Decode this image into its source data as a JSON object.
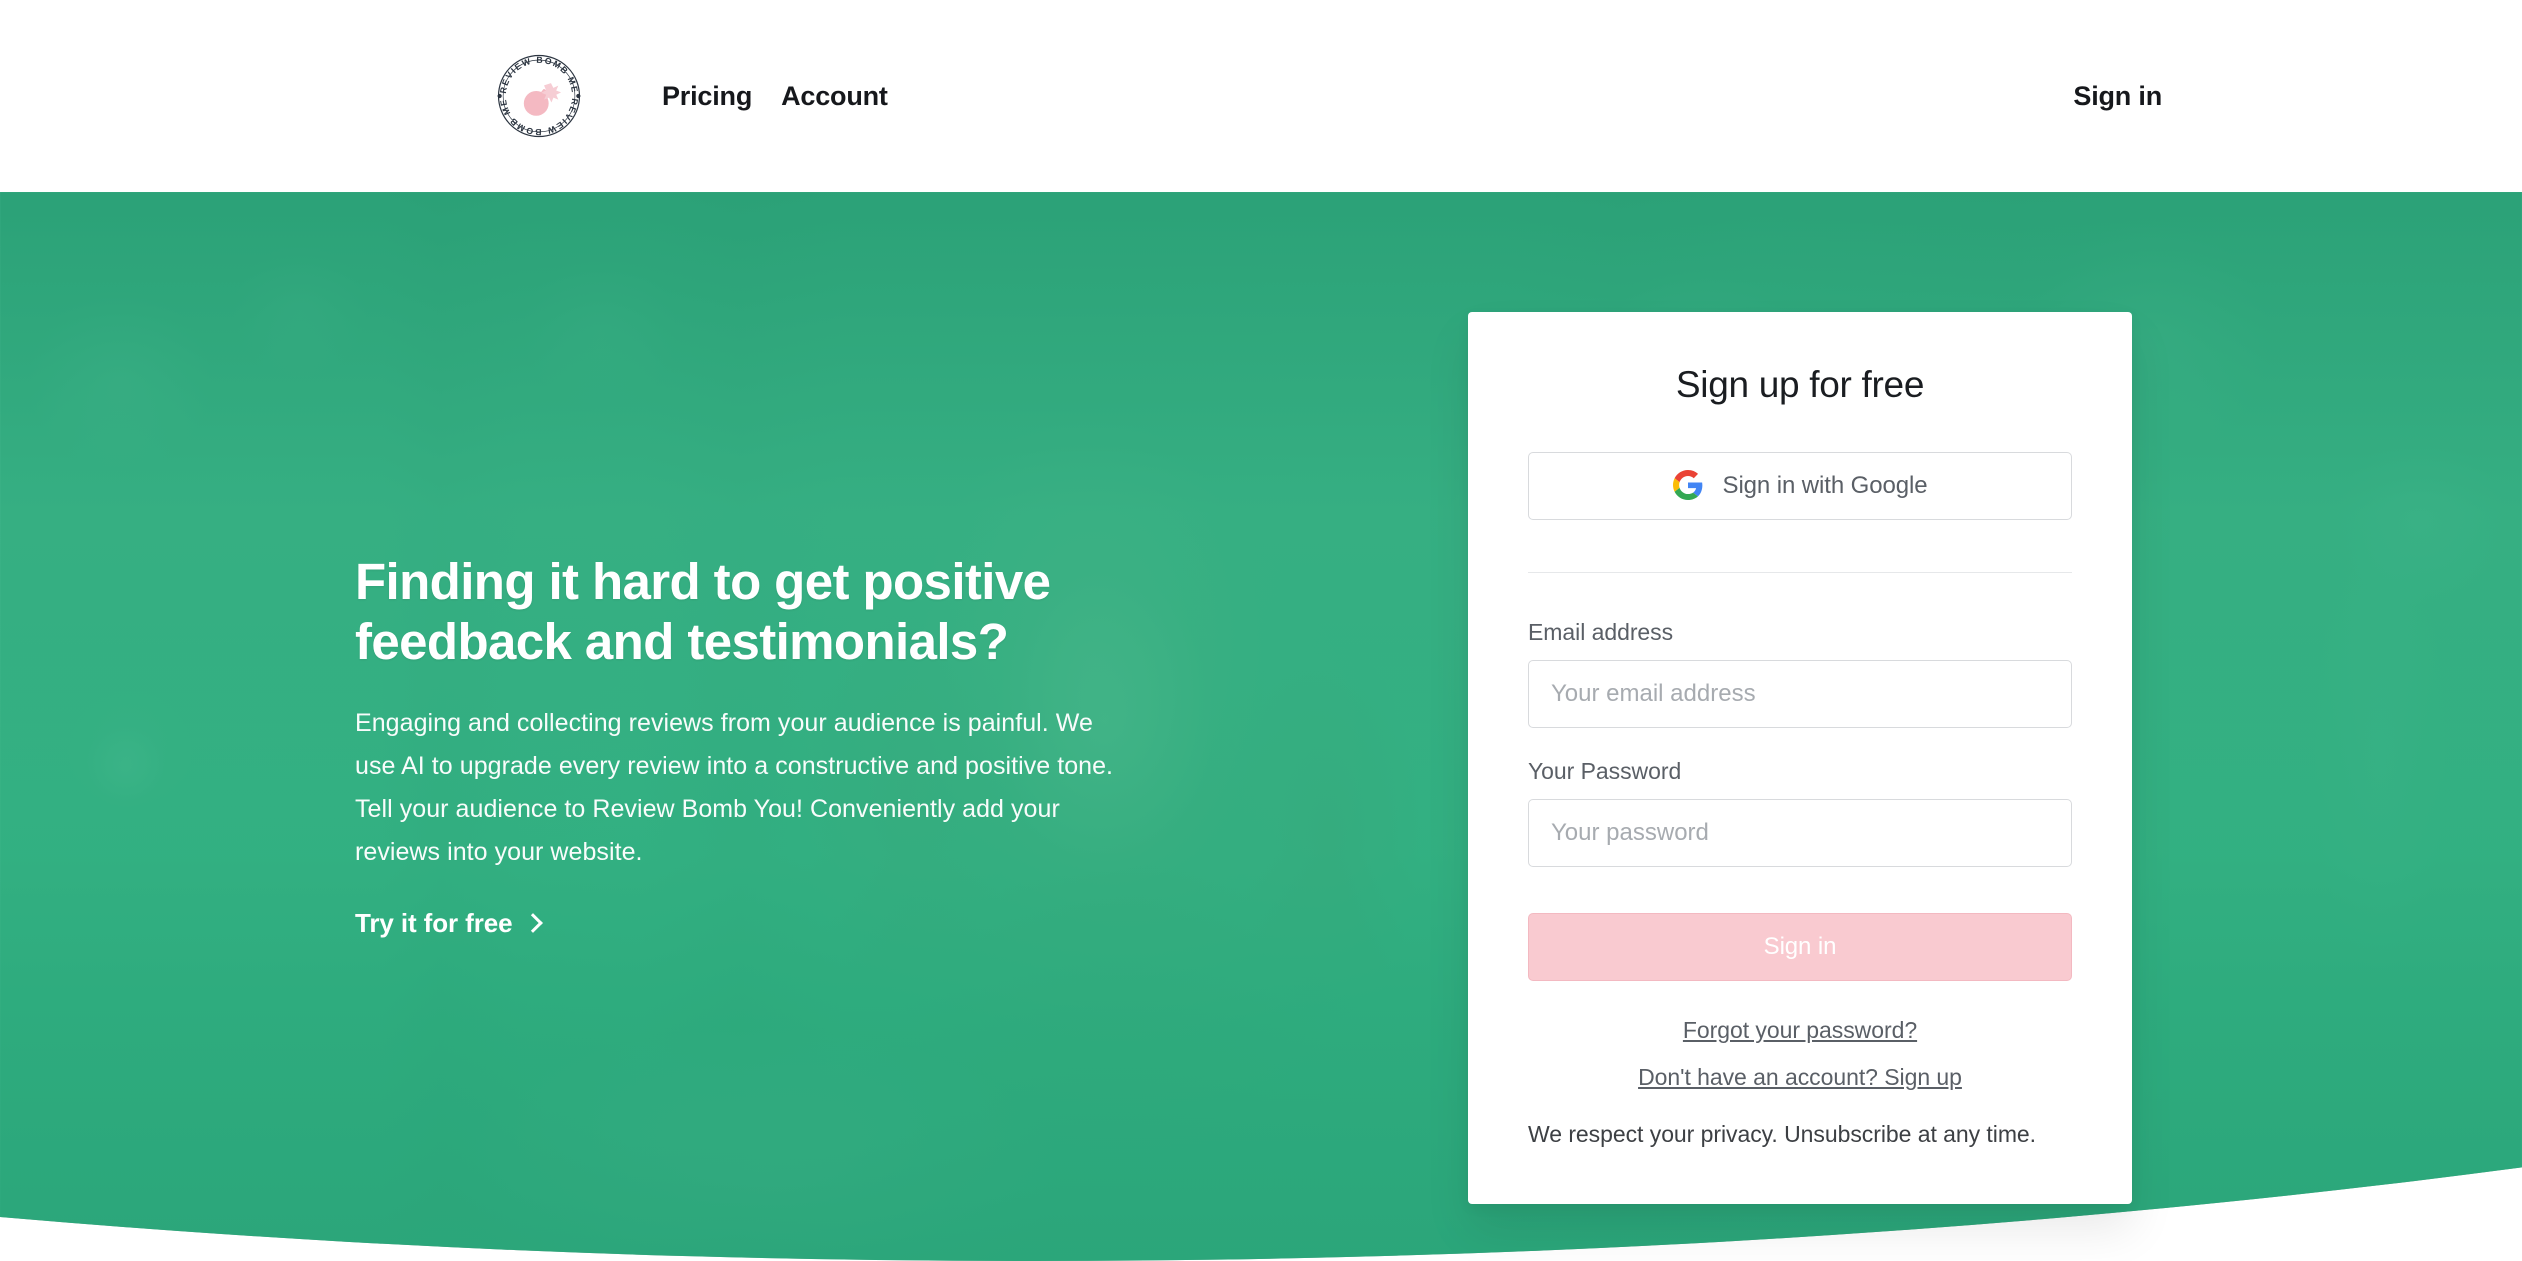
{
  "header": {
    "logo": {
      "name": "review-bomb-me-badge",
      "text_top": "REVIEW BOMB ME",
      "text_bottom": "REVIEW BOMB ME",
      "color": "#f4b9c2"
    },
    "nav": [
      {
        "label": "Pricing",
        "name": "nav-link-pricing"
      },
      {
        "label": "Account",
        "name": "nav-link-account"
      }
    ],
    "signin_label": "Sign in"
  },
  "hero": {
    "title": "Finding it hard to get positive feedback and testimonials?",
    "subtitle": "Engaging and collecting reviews from your audience is painful. We use AI to upgrade every review into a constructive and positive tone. Tell your audience to Review Bomb You! Conveniently add your reviews into your website.",
    "cta_label": "Try it for free",
    "overlay_color": "#35b385"
  },
  "card": {
    "title": "Sign up for free",
    "google_button_label": "Sign in with Google",
    "email": {
      "label": "Email address",
      "placeholder": "Your email address",
      "value": ""
    },
    "password": {
      "label": "Your Password",
      "placeholder": "Your password",
      "value": ""
    },
    "submit_label": "Sign in",
    "submit_color": "#f9cad0",
    "forgot_link": "Forgot your password?",
    "signup_link": "Don't have an account? Sign up",
    "privacy_note": "We respect your privacy. Unsubscribe at any time."
  }
}
